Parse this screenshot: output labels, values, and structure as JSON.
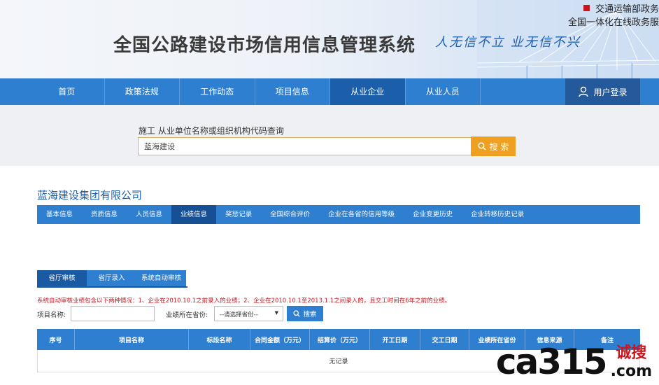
{
  "header": {
    "title": "全国公路建设市场信用信息管理系统",
    "slogan": "人无信不立 业无信不兴",
    "top_link_1": "交通运输部政务",
    "top_link_2": "全国一体化在线政务服"
  },
  "nav": {
    "items": [
      {
        "label": "首页"
      },
      {
        "label": "政策法规"
      },
      {
        "label": "工作动态"
      },
      {
        "label": "项目信息"
      },
      {
        "label": "从业企业"
      },
      {
        "label": "从业人员"
      }
    ],
    "active": "从业企业",
    "login_label": "用户登录"
  },
  "search": {
    "caption": "施工 从业单位名称或组织机构代码查询",
    "value": "蓝海建设",
    "button_label": "搜 索"
  },
  "company": {
    "name": "蓝海建设集团有限公司",
    "tabs": [
      {
        "label": "基本信息"
      },
      {
        "label": "资质信息"
      },
      {
        "label": "人员信息"
      },
      {
        "label": "业绩信息"
      },
      {
        "label": "奖惩记录"
      },
      {
        "label": "全国综合评价"
      },
      {
        "label": "企业在各省的信用等级"
      },
      {
        "label": "企业变更历史"
      },
      {
        "label": "企业转移历史记录"
      }
    ],
    "active_tab": "业绩信息"
  },
  "subtabs": {
    "items": [
      {
        "label": "省厅审核"
      },
      {
        "label": "省厅录入"
      },
      {
        "label": "系统自动审核"
      }
    ],
    "active": "省厅审核"
  },
  "notice": "系统自动审核业绩包含以下两种情况：1、企业在2010.10.1之前录入的业绩；2、企业在2010.10.1至2013.1.1之间录入的，且交工时间在6年之前的业绩。",
  "filter": {
    "project_label": "项目名称:",
    "project_value": "",
    "province_label": "业绩所在省份:",
    "province_selected": "--请选择省份--",
    "button_label": "搜索"
  },
  "table": {
    "columns": [
      "序号",
      "项目名称",
      "标段名称",
      "合同金额（万元）",
      "结算价（万元）",
      "开工日期",
      "交工日期",
      "业绩所在省份",
      "信息来源",
      "备注"
    ],
    "empty_text": "无记录"
  },
  "watermark": {
    "brand": "ca315",
    "cn": "诚搜",
    "suffix": ".com"
  },
  "colors": {
    "nav_blue": "#2f7fd0",
    "active_blue": "#1b5fab",
    "search_orange": "#f0a020",
    "notice_red": "#d0151c"
  }
}
